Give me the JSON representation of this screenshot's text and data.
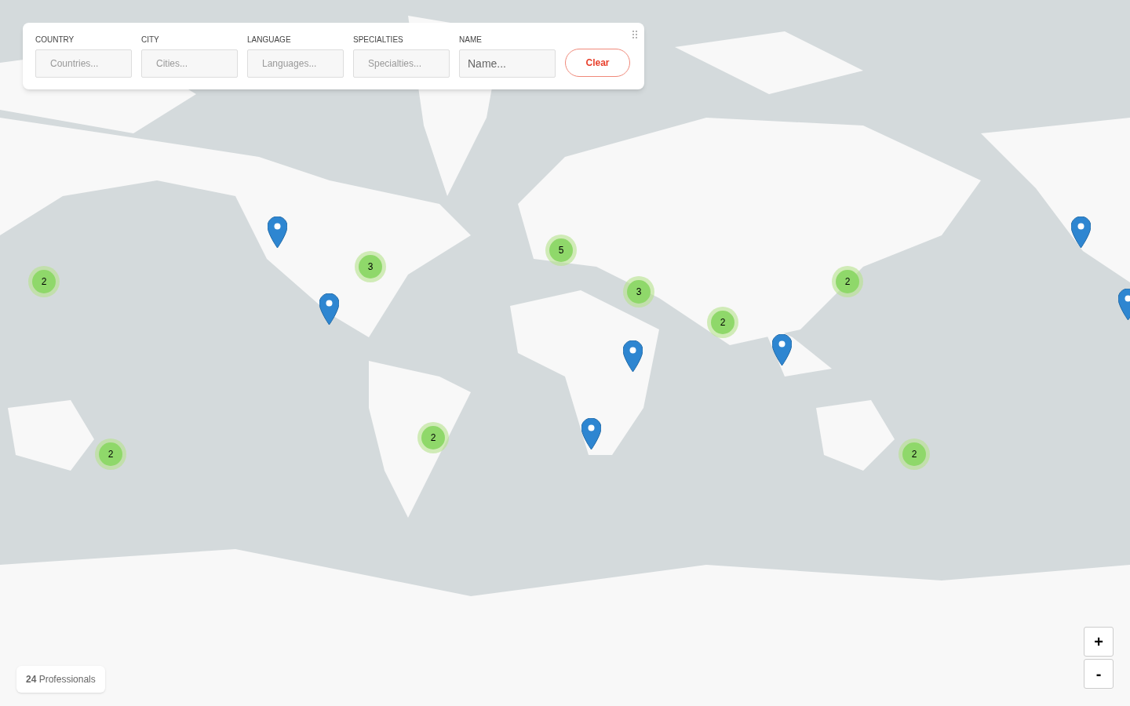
{
  "filters": [
    {
      "label": "COUNTRY",
      "placeholder": "Countries..."
    },
    {
      "label": "CITY",
      "placeholder": "Cities..."
    },
    {
      "label": "LANGUAGE",
      "placeholder": "Languages..."
    },
    {
      "label": "SPECIALTIES",
      "placeholder": "Specialties..."
    },
    {
      "label": "NAME",
      "placeholder": "Name..."
    }
  ],
  "clear_button": "Clear",
  "markers": [
    {
      "kind": "pin"
    },
    {
      "kind": "pin"
    },
    {
      "kind": "cluster",
      "count": "5"
    },
    {
      "kind": "cluster",
      "count": "3"
    },
    {
      "kind": "cluster",
      "count": "2"
    },
    {
      "kind": "cluster",
      "count": "2"
    },
    {
      "kind": "cluster",
      "count": "3"
    },
    {
      "kind": "pin"
    },
    {
      "kind": "cluster",
      "count": "2"
    },
    {
      "kind": "pin"
    },
    {
      "kind": "pin"
    },
    {
      "kind": "pin"
    },
    {
      "kind": "cluster",
      "count": "2"
    },
    {
      "kind": "pin"
    },
    {
      "kind": "cluster",
      "count": "2"
    },
    {
      "kind": "cluster",
      "count": "2"
    }
  ],
  "result_count": "**24** Professionals",
  "zoom_controls": [
    "+",
    "-"
  ]
}
